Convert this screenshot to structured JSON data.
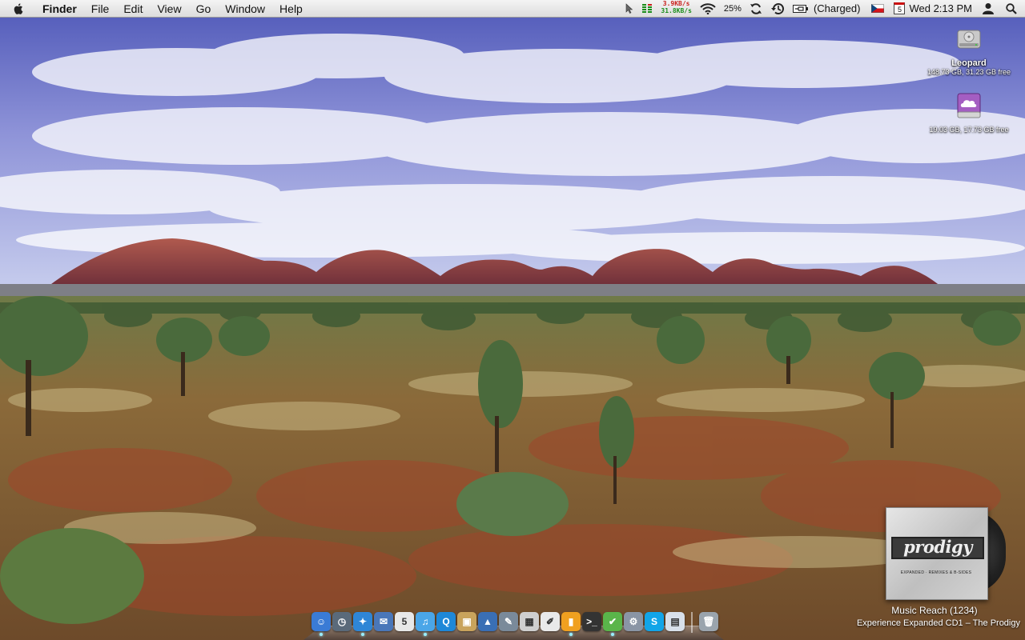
{
  "menubar": {
    "app_name": "Finder",
    "menus": [
      "File",
      "Edit",
      "View",
      "Go",
      "Window",
      "Help"
    ],
    "status": {
      "net_up": "3.9KB/s",
      "net_down": "31.8KB/s",
      "battery_percent": "25%",
      "power_state": "(Charged)",
      "calendar_day": "5",
      "clock": "Wed 2:13 PM"
    },
    "icons": [
      "apple-icon",
      "cursor-icon",
      "cpu-meter-icon",
      "wifi-icon",
      "sync-icon",
      "time-machine-icon",
      "battery-icon",
      "czech-flag-icon",
      "calendar-icon",
      "user-icon",
      "spotlight-icon"
    ]
  },
  "desktop": {
    "drives": [
      {
        "name": "Leopard",
        "info": "148.73 GB, 31.23 GB free",
        "icon": "hard-drive-icon"
      },
      {
        "name": "",
        "info": "19.03 GB, 17.73 GB free",
        "icon": "cloud-drive-icon"
      }
    ]
  },
  "now_playing": {
    "album_logo": "prodigy",
    "album_subtitle": "EXPANDED · REMIXES & B-SIDES",
    "track": "Music Reach (1234)",
    "album_artist": "Experience Expanded CD1 – The Prodigy"
  },
  "dock": {
    "apps": [
      {
        "name": "finder",
        "icon": "finder-icon",
        "glyph": "☺",
        "color": "#3a7bd5",
        "running": true
      },
      {
        "name": "time-machine",
        "icon": "time-machine-icon",
        "glyph": "◷",
        "color": "#5a6a7a",
        "running": false
      },
      {
        "name": "safari",
        "icon": "safari-icon",
        "glyph": "✦",
        "color": "#2f86d6",
        "running": true
      },
      {
        "name": "mail",
        "icon": "mail-icon",
        "glyph": "✉",
        "color": "#4a77b9",
        "running": false
      },
      {
        "name": "ical",
        "icon": "ical-icon",
        "glyph": "5",
        "color": "#e8e8e8",
        "running": false
      },
      {
        "name": "itunes",
        "icon": "itunes-icon",
        "glyph": "♫",
        "color": "#4aa6e8",
        "running": true
      },
      {
        "name": "quicktime",
        "icon": "quicktime-icon",
        "glyph": "Q",
        "color": "#1e88d8",
        "running": false
      },
      {
        "name": "preview",
        "icon": "preview-icon",
        "glyph": "▣",
        "color": "#c9a35c",
        "running": false
      },
      {
        "name": "keynote",
        "icon": "keynote-icon",
        "glyph": "▲",
        "color": "#3a6fb5",
        "running": false
      },
      {
        "name": "xcode",
        "icon": "xcode-icon",
        "glyph": "✎",
        "color": "#7a8a9a",
        "running": false
      },
      {
        "name": "calculator",
        "icon": "calculator-icon",
        "glyph": "▦",
        "color": "#cfcfcf",
        "running": false
      },
      {
        "name": "textedit",
        "icon": "textedit-icon",
        "glyph": "✐",
        "color": "#e9e9e9",
        "running": false
      },
      {
        "name": "activity-monitor",
        "icon": "activity-monitor-icon",
        "glyph": "▮",
        "color": "#f0a020",
        "running": true
      },
      {
        "name": "terminal",
        "icon": "terminal-icon",
        "glyph": ">_",
        "color": "#333333",
        "running": false
      },
      {
        "name": "ichat",
        "icon": "ichat-icon",
        "glyph": "✔",
        "color": "#5ab54a",
        "running": true
      },
      {
        "name": "utilities",
        "icon": "utilities-icon",
        "glyph": "⚙",
        "color": "#8a95a5",
        "running": false
      },
      {
        "name": "skype",
        "icon": "skype-icon",
        "glyph": "S",
        "color": "#12a5e8",
        "running": false
      },
      {
        "name": "documents",
        "icon": "documents-stack-icon",
        "glyph": "▤",
        "color": "#d8e0ea",
        "running": false
      }
    ],
    "trash": {
      "name": "trash",
      "icon": "trash-icon",
      "glyph": "🗑",
      "color": "#9aa4ad"
    }
  }
}
